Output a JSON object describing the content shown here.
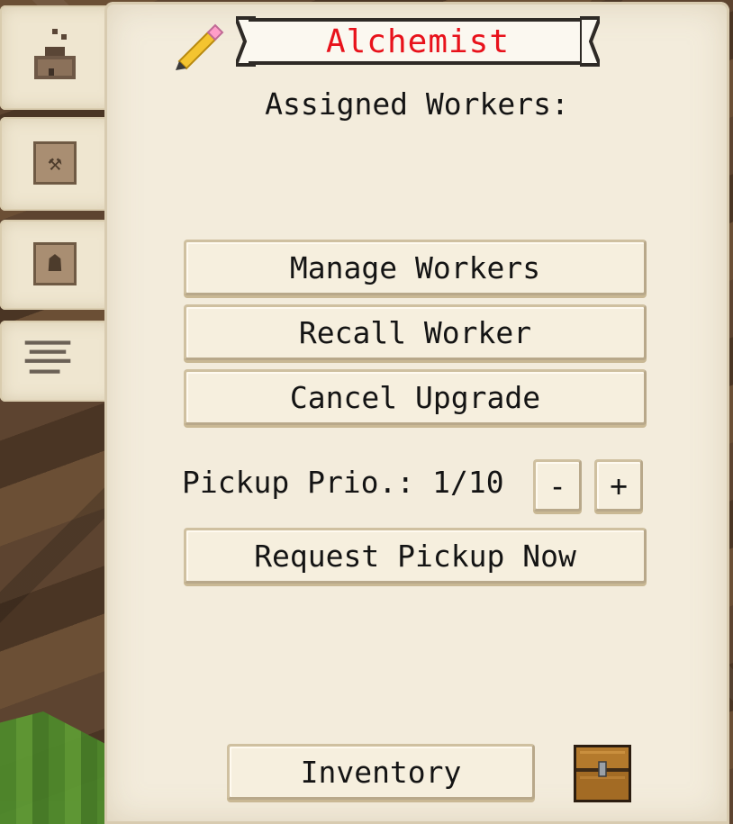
{
  "header": {
    "title": "Alchemist"
  },
  "main": {
    "assigned_heading": "Assigned Workers:",
    "buttons": {
      "manage_workers": "Manage Workers",
      "recall_worker": "Recall Worker",
      "cancel_upgrade": "Cancel Upgrade",
      "request_pickup": "Request Pickup Now",
      "inventory": "Inventory"
    },
    "pickup": {
      "label": "Pickup Prio.: 1/10",
      "decrease": "-",
      "increase": "+"
    }
  },
  "tabs": [
    {
      "icon": "hut-upgrade-icon"
    },
    {
      "icon": "tools-icon"
    },
    {
      "icon": "worker-icon"
    },
    {
      "icon": "list-icon"
    }
  ],
  "colors": {
    "title_red": "#e8121b",
    "parchment": "#f3ecdc",
    "text": "#141414"
  }
}
